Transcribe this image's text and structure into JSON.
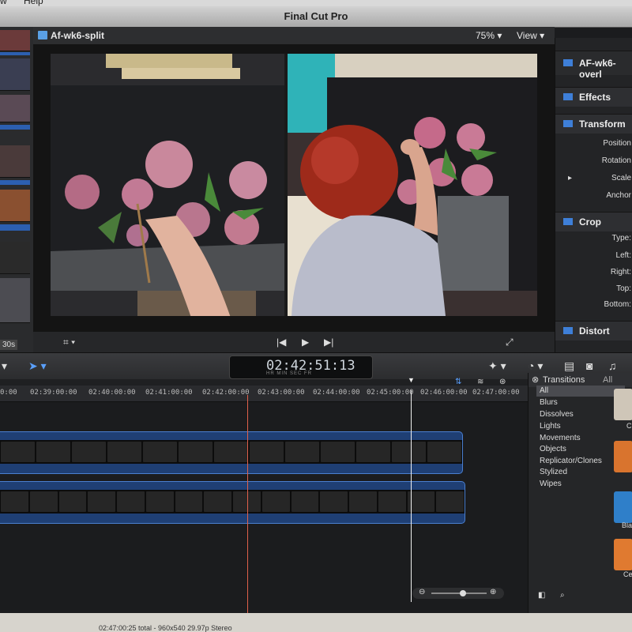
{
  "menubar": {
    "items": [
      "w",
      "Help"
    ]
  },
  "window": {
    "title": "Final Cut Pro"
  },
  "browser": {
    "duration_badge": "30s"
  },
  "viewer": {
    "clip_name": "Af-wk6-split",
    "zoom": "75%",
    "view_label": "View"
  },
  "inspector": {
    "clip_name": "AF-wk6-overl",
    "effects_label": "Effects",
    "transform_label": "Transform",
    "transform_rows": [
      "Position",
      "Rotation",
      "Scale",
      "Anchor"
    ],
    "crop_label": "Crop",
    "crop_rows": [
      "Type:",
      "Left:",
      "Right:",
      "Top:",
      "Bottom:"
    ],
    "distort_label": "Distort"
  },
  "toolbar": {
    "timecode": "02:42:51:13",
    "timecode_units": "HR   MIN   SEC   FR"
  },
  "timeline": {
    "ruler_labels": [
      "0:00",
      "02:39:00:00",
      "02:40:00:00",
      "02:41:00:00",
      "02:42:00:00",
      "02:43:00:00",
      "02:44:00:00",
      "02:45:00:00",
      "02:46:00:00",
      "02:47:00:00"
    ]
  },
  "transitions": {
    "title": "Transitions",
    "filter": "All",
    "categories": [
      "All",
      "Blurs",
      "Dissolves",
      "Lights",
      "Movements",
      "Objects",
      "Replicator/Clones",
      "Stylized",
      "Wipes"
    ],
    "thumb_labels": [
      "C",
      "Bla",
      "Ce"
    ]
  },
  "status": {
    "text": "02:47:00:25 total - 960x540 29.97p Stereo"
  },
  "colors": {
    "accent_blue": "#2c5fb0",
    "playhead_red": "#e0604a",
    "skimmer_white": "#f0f0f0"
  }
}
